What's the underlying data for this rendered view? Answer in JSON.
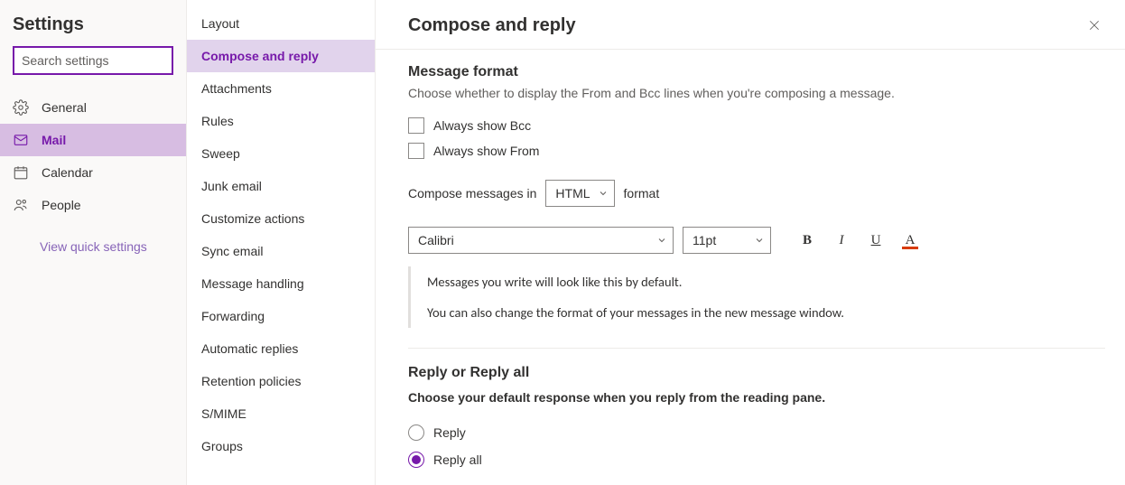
{
  "sidebar": {
    "title": "Settings",
    "search_placeholder": "Search settings",
    "items": [
      {
        "id": "general",
        "label": "General"
      },
      {
        "id": "mail",
        "label": "Mail"
      },
      {
        "id": "calendar",
        "label": "Calendar"
      },
      {
        "id": "people",
        "label": "People"
      }
    ],
    "selected": "mail",
    "quick_link": "View quick settings"
  },
  "subnav": {
    "items": [
      "Layout",
      "Compose and reply",
      "Attachments",
      "Rules",
      "Sweep",
      "Junk email",
      "Customize actions",
      "Sync email",
      "Message handling",
      "Forwarding",
      "Automatic replies",
      "Retention policies",
      "S/MIME",
      "Groups"
    ],
    "selected_index": 1
  },
  "panel": {
    "title": "Compose and reply",
    "msg_format": {
      "heading": "Message format",
      "desc": "Choose whether to display the From and Bcc lines when you're composing a message.",
      "bcc_label": "Always show Bcc",
      "from_label": "Always show From",
      "compose_prefix": "Compose messages in",
      "compose_value": "HTML",
      "compose_suffix": "format",
      "font_value": "Calibri",
      "size_value": "11pt",
      "preview_line1": "Messages you write will look like this by default.",
      "preview_line2": "You can also change the format of your messages in the new message window."
    },
    "reply": {
      "heading": "Reply or Reply all",
      "desc": "Choose your default response when you reply from the reading pane.",
      "option_reply": "Reply",
      "option_reply_all": "Reply all",
      "selected": "reply_all"
    }
  }
}
